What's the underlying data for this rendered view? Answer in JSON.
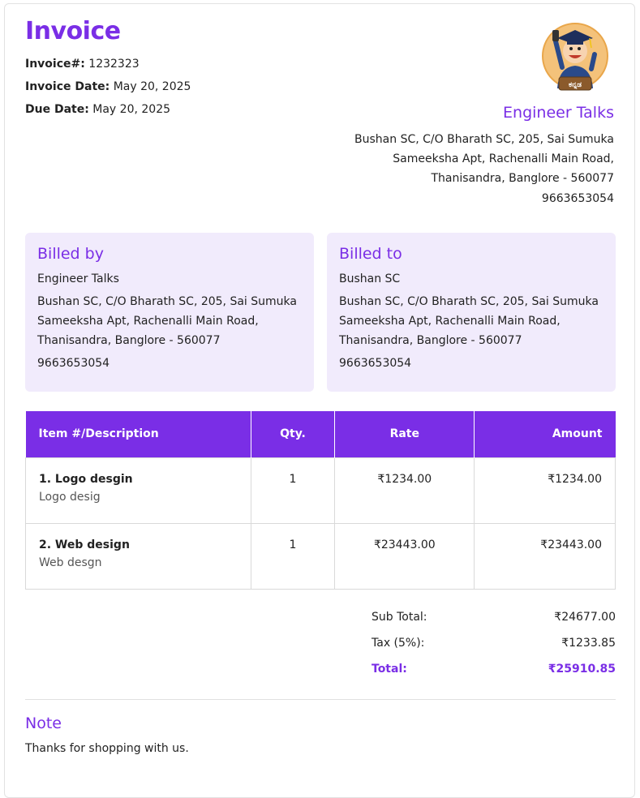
{
  "header": {
    "title": "Invoice",
    "invoice_no_label": "Invoice#:",
    "invoice_no": "1232323",
    "invoice_date_label": "Invoice Date:",
    "invoice_date": "May 20, 2025",
    "due_date_label": "Due Date:",
    "due_date": "May 20, 2025"
  },
  "company": {
    "name": "Engineer Talks",
    "logo_text": "ಕನ್ನಡ",
    "address_line1": "Bushan SC, C/O Bharath SC, 205, Sai Sumuka",
    "address_line2": "Sameeksha Apt, Rachenalli Main Road,",
    "address_line3": "Thanisandra, Banglore - 560077",
    "phone": "9663653054"
  },
  "billed_by": {
    "title": "Billed by",
    "name": "Engineer Talks",
    "address_line1": "Bushan SC, C/O Bharath SC, 205, Sai Sumuka",
    "address_line2": "Sameeksha Apt, Rachenalli Main Road,",
    "address_line3": "Thanisandra, Banglore - 560077",
    "phone": "9663653054"
  },
  "billed_to": {
    "title": "Billed to",
    "name": "Bushan SC",
    "address_line1": "Bushan SC, C/O Bharath SC, 205, Sai Sumuka",
    "address_line2": "Sameeksha Apt, Rachenalli Main Road,",
    "address_line3": "Thanisandra, Banglore - 560077",
    "phone": "9663653054"
  },
  "table": {
    "headers": [
      "Item #/Description",
      "Qty.",
      "Rate",
      "Amount"
    ],
    "rows": [
      {
        "name": "1. Logo desgin",
        "desc": "Logo desig",
        "qty": "1",
        "rate": "₹1234.00",
        "amount": "₹1234.00"
      },
      {
        "name": "2. Web design",
        "desc": "Web desgn",
        "qty": "1",
        "rate": "₹23443.00",
        "amount": "₹23443.00"
      }
    ]
  },
  "totals": {
    "subtotal_label": "Sub Total:",
    "subtotal": "₹24677.00",
    "tax_label": "Tax (5%):",
    "tax": "₹1233.85",
    "total_label": "Total:",
    "total": "₹25910.85"
  },
  "note": {
    "title": "Note",
    "text": "Thanks for shopping with us."
  },
  "colors": {
    "accent": "#7a2ee6",
    "card_bg": "#f1ebfc"
  }
}
